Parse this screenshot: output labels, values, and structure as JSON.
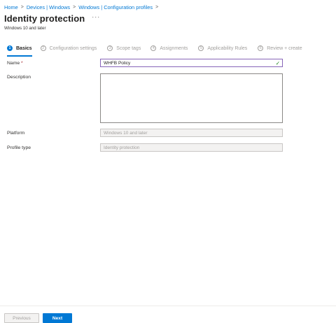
{
  "breadcrumb": {
    "items": [
      "Home",
      "Devices | Windows",
      "Windows | Configuration profiles"
    ],
    "separator": ">"
  },
  "header": {
    "title": "Identity protection",
    "more_label": "···",
    "subtitle": "Windows 10 and later"
  },
  "wizard": {
    "steps": [
      {
        "num": "1",
        "label": "Basics",
        "active": true
      },
      {
        "num": "2",
        "label": "Configuration settings"
      },
      {
        "num": "3",
        "label": "Scope tags"
      },
      {
        "num": "4",
        "label": "Assignments"
      },
      {
        "num": "5",
        "label": "Applicability Rules"
      },
      {
        "num": "6",
        "label": "Review + create"
      }
    ]
  },
  "form": {
    "name_label": "Name",
    "name_required": "*",
    "name_value": "WHFB Policy",
    "description_label": "Description",
    "description_value": "",
    "platform_label": "Platform",
    "platform_value": "Windows 10 and later",
    "profile_type_label": "Profile type",
    "profile_type_value": "Identity protection"
  },
  "footer": {
    "previous_label": "Previous",
    "next_label": "Next"
  },
  "colors": {
    "accent": "#0078d4",
    "focus_border": "#8764b8",
    "valid_check": "#107c10"
  },
  "icons": {
    "valid": "checkmark-icon",
    "more": "more-icon",
    "chevron": "chevron-right-icon"
  }
}
